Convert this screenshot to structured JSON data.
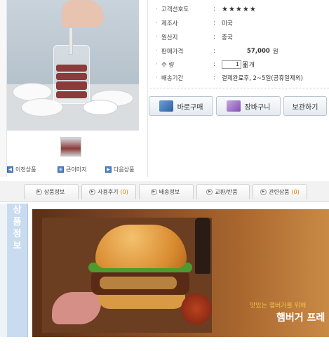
{
  "product_info": {
    "rows": [
      {
        "label": "고객선호도",
        "value": "★★★★★"
      },
      {
        "label": "제조사",
        "value": "미국"
      },
      {
        "label": "원산지",
        "value": "중국"
      },
      {
        "label": "판매가격",
        "value": "57,000",
        "unit": "원"
      },
      {
        "label": "수 량",
        "value": "1",
        "unit": "개"
      },
      {
        "label": "배송기간",
        "value": "결제완료후, 2~5일(공휴일제외)"
      }
    ]
  },
  "actions": {
    "buy_now": "바로구매",
    "cart": "장바구니",
    "wishlist": "보관하기"
  },
  "image_nav": {
    "prev": "이전상품",
    "zoom": "큰이미지",
    "next": "다음상품"
  },
  "tabs": [
    {
      "label": "상품정보",
      "count": ""
    },
    {
      "label": "사용후기",
      "count": "(0)"
    },
    {
      "label": "배송정보",
      "count": ""
    },
    {
      "label": "교환/반품",
      "count": ""
    },
    {
      "label": "관련상품",
      "count": "(0)"
    }
  ],
  "section_label": [
    "상",
    "품",
    "정",
    "보"
  ],
  "banner": {
    "subtitle": "맛있는 햄버거를 위해",
    "title": "햄버거 프레"
  },
  "colors": {
    "price": "#2c4fa6",
    "delivery": "#d0312d",
    "stars": "#f2b400",
    "tab_count": "#e07b00",
    "section_label_bg": "#c9dcef"
  }
}
